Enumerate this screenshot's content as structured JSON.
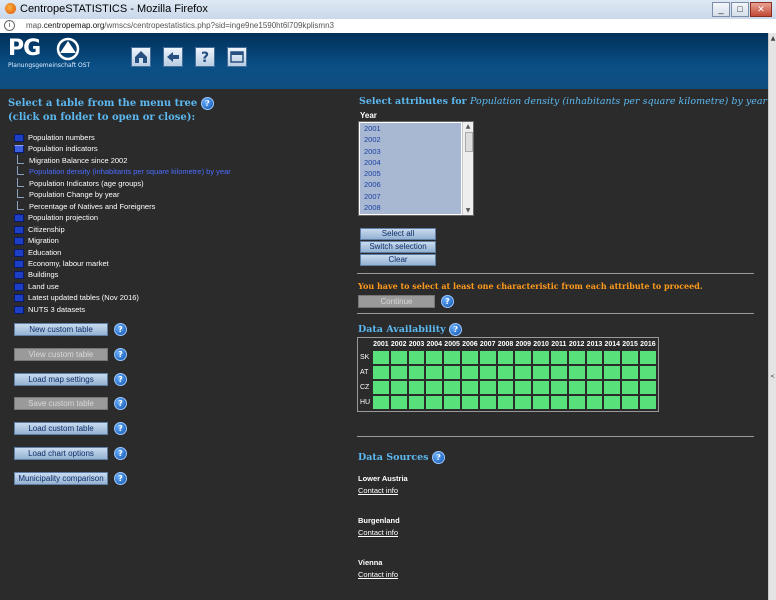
{
  "window": {
    "title": "CentropeSTATISTICS - Mozilla Firefox",
    "min": "_",
    "max": "□",
    "close": "✕"
  },
  "urlbar": {
    "prefix": "map.",
    "domain": "centropemap.org",
    "path": "/wmscs/centropestatistics.php?sid=inge9ne1590ht6l709kplismn3"
  },
  "logo": {
    "text": "PG",
    "subtitle": "Planungsgemeinschaft OST"
  },
  "nav": [
    "home-icon",
    "back-icon",
    "help-icon",
    "window-icon"
  ],
  "left": {
    "title_line1": "Select a table from the menu tree",
    "title_line2": "(click on folder to open or close):",
    "help": "?",
    "tree": [
      {
        "label": "Population numbers",
        "kind": "folder"
      },
      {
        "label": "Population indicators",
        "kind": "open"
      },
      {
        "label": "Migration Balance since 2002",
        "kind": "leaf"
      },
      {
        "label": "Population density (inhabitants per square kilometre) by year",
        "kind": "selected"
      },
      {
        "label": "Population Indicators (age groups)",
        "kind": "leaf"
      },
      {
        "label": "Population Change by year",
        "kind": "leaf"
      },
      {
        "label": "Percentage of Natives and Foreigners",
        "kind": "leaf"
      },
      {
        "label": "Population projection",
        "kind": "folder"
      },
      {
        "label": "Citizenship",
        "kind": "folder"
      },
      {
        "label": "Migration",
        "kind": "folder"
      },
      {
        "label": "Education",
        "kind": "folder"
      },
      {
        "label": "Economy, labour market",
        "kind": "folder"
      },
      {
        "label": "Buildings",
        "kind": "folder"
      },
      {
        "label": "Land use",
        "kind": "folder"
      },
      {
        "label": "Latest updated tables (Nov 2016)",
        "kind": "folder"
      },
      {
        "label": "NUTS 3 datasets",
        "kind": "folder"
      }
    ],
    "buttons": [
      {
        "label": "New custom table",
        "disabled": false
      },
      {
        "label": "View custom table",
        "disabled": true
      },
      {
        "label": "Load map settings",
        "disabled": false
      },
      {
        "label": "Save custom table",
        "disabled": true
      },
      {
        "label": "Load custom table",
        "disabled": false
      },
      {
        "label": "Load chart options",
        "disabled": false
      },
      {
        "label": "Municipality comparison",
        "disabled": false
      }
    ]
  },
  "right": {
    "title_prefix": "Select attributes for ",
    "title_italic": "Population density (inhabitants per square kilometre) by year",
    "year_label": "Year",
    "years": [
      "2001",
      "2002",
      "2003",
      "2004",
      "2005",
      "2006",
      "2007",
      "2008"
    ],
    "select_all": "Select all",
    "switch": "Switch selection",
    "clear": "Clear",
    "warning": "You have to select at least one characteristic from each attribute to proceed.",
    "continue": "Continue",
    "availability_title": "Data Availability",
    "availability_years": [
      "2001",
      "2002",
      "2003",
      "2004",
      "2005",
      "2006",
      "2007",
      "2008",
      "2009",
      "2010",
      "2011",
      "2012",
      "2013",
      "2014",
      "2015",
      "2016"
    ],
    "availability_rows": [
      "SK",
      "AT",
      "CZ",
      "HU"
    ],
    "sources_title": "Data Sources",
    "sources": [
      {
        "name": "Lower Austria",
        "link": "Contact info"
      },
      {
        "name": "Burgenland",
        "link": "Contact info"
      },
      {
        "name": "Vienna",
        "link": "Contact info"
      }
    ]
  },
  "colors": {
    "background": "#2b2b2b",
    "heading": "#5cb8f0",
    "warning": "#ff9a1a",
    "available": "#58e07a",
    "selected_tree": "#4a6cff"
  }
}
